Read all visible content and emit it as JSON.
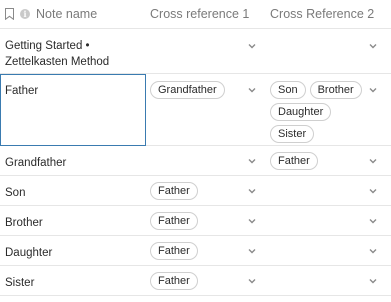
{
  "header": {
    "name": "Note name",
    "ref1": "Cross reference 1",
    "ref2": "Cross Reference 2",
    "info": "i"
  },
  "rows": [
    {
      "name": "Getting Started • Zettelkasten Method",
      "ref1": [],
      "ref2": []
    },
    {
      "name": "Father",
      "ref1": [
        "Grandfather"
      ],
      "ref2": [
        "Son",
        "Brother",
        "Daughter",
        "Sister"
      ]
    },
    {
      "name": "Grandfather",
      "ref1": [],
      "ref2": [
        "Father"
      ]
    },
    {
      "name": "Son",
      "ref1": [
        "Father"
      ],
      "ref2": []
    },
    {
      "name": "Brother",
      "ref1": [
        "Father"
      ],
      "ref2": []
    },
    {
      "name": "Daughter",
      "ref1": [
        "Father"
      ],
      "ref2": []
    },
    {
      "name": "Sister",
      "ref1": [
        "Father"
      ],
      "ref2": []
    }
  ],
  "colors": {
    "focus_border": "#3a7bb0",
    "chip_border": "#cfcfcf",
    "header_text": "#7a7a7a"
  },
  "icons": {
    "bookmark": "bookmark-icon",
    "info": "info-icon",
    "dropdown": "chevron-down-icon"
  }
}
